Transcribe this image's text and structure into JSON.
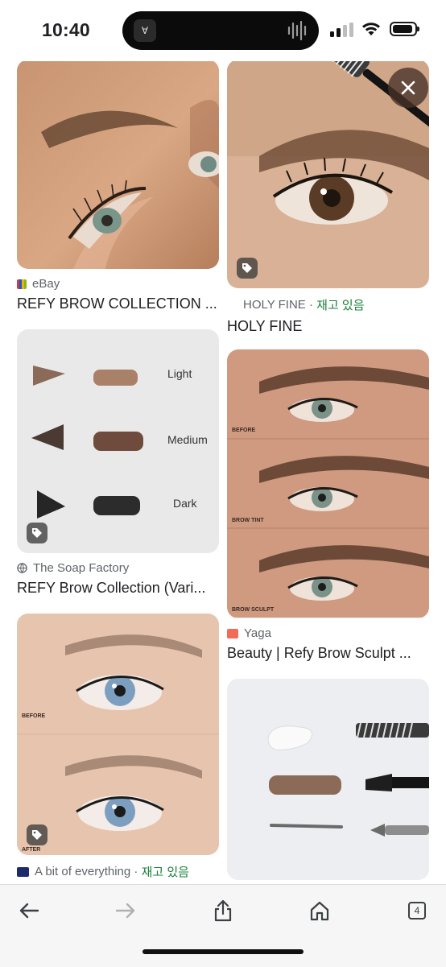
{
  "status": {
    "time": "10:40",
    "island_app_glyph": "∀"
  },
  "cards": {
    "c1": {
      "source": "eBay",
      "title": "REFY BROW COLLECTION ..."
    },
    "c2": {
      "source": "HOLY FINE",
      "stock": "재고 있음",
      "title": "HOLY FINE"
    },
    "c3": {
      "source": "The Soap Factory",
      "title": "REFY Brow Collection (Vari...",
      "swatches": [
        "Light",
        "Medium",
        "Dark"
      ]
    },
    "c4": {
      "source": "Yaga",
      "title": "Beauty | Refy Brow Sculpt ...",
      "panel_labels": [
        "BEFORE",
        "BROW TINT",
        "BROW SCULPT"
      ]
    },
    "c5": {
      "source": "A bit of everything",
      "stock": "재고 있음",
      "panel_labels": [
        "BEFORE",
        "AFTER"
      ]
    }
  },
  "toolbar": {
    "tabs_count": "4"
  },
  "icons": [
    "close-icon",
    "tag-icon",
    "back-arrow-icon",
    "forward-arrow-icon",
    "share-icon",
    "home-icon",
    "tabs-icon",
    "signal-icon",
    "wifi-icon",
    "battery-icon"
  ],
  "colors": {
    "stock_green": "#188038",
    "toolbar_bg": "#f6f6f6"
  }
}
